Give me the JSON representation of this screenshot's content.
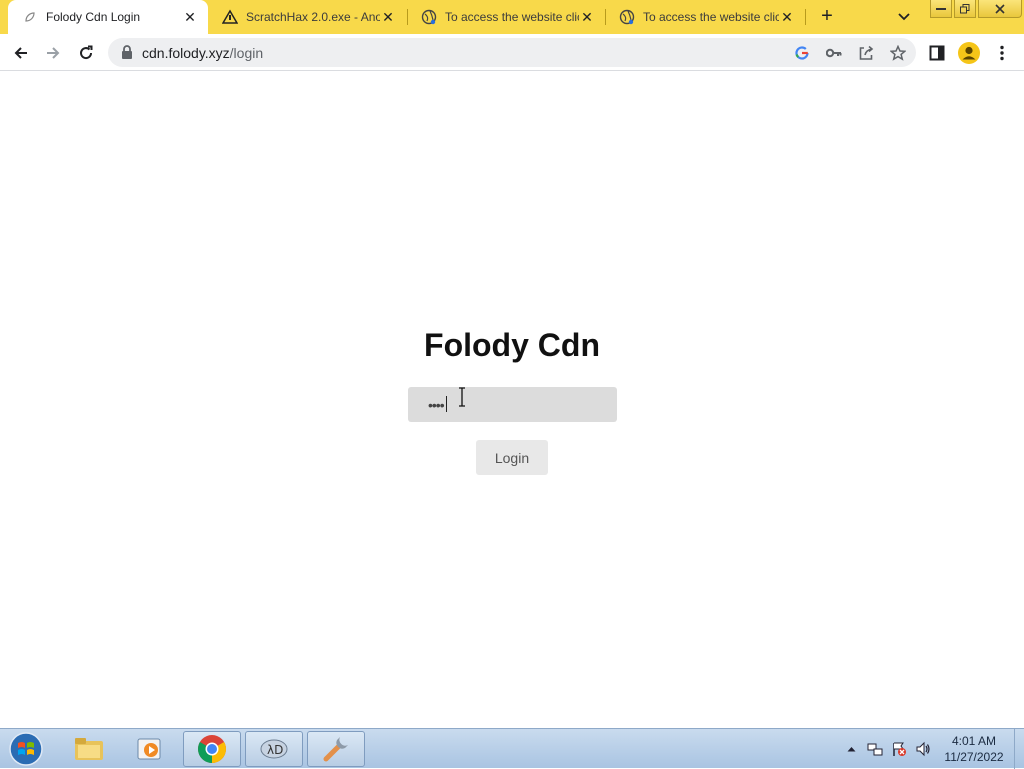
{
  "browser": {
    "tabs": [
      {
        "title": "Folody Cdn Login",
        "active": true,
        "favicon": "leaf-icon"
      },
      {
        "title": "ScratchHax 2.0.exe - Ano",
        "active": false,
        "favicon": "warning-icon"
      },
      {
        "title": "To access the website clic",
        "active": false,
        "favicon": "globe-icon"
      },
      {
        "title": "To access the website clic",
        "active": false,
        "favicon": "globe-icon"
      }
    ],
    "new_tab_label": "+",
    "address": {
      "host": "cdn.folody.xyz",
      "path": "/login"
    },
    "colors": {
      "tabstrip": "#f8d94a",
      "toolbar": "#ffffff",
      "omnibox": "#eeeff1"
    }
  },
  "page": {
    "title": "Folody Cdn",
    "password": {
      "value": "••••",
      "type": "password"
    },
    "login_button": "Login"
  },
  "taskbar": {
    "apps": [
      "file-explorer-icon",
      "media-player-icon",
      "chrome-icon",
      "network-tool-icon",
      "tools-icon"
    ],
    "clock": {
      "time": "4:01 AM",
      "date": "11/27/2022"
    }
  }
}
